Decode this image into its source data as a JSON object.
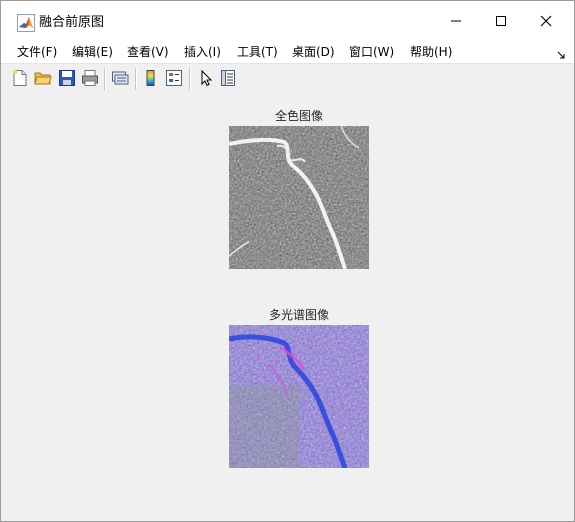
{
  "window": {
    "title": "融合前原图",
    "controls": {
      "minimize": "minimize",
      "maximize": "maximize",
      "close": "close"
    }
  },
  "menu": {
    "items": [
      {
        "label": "文件(F)"
      },
      {
        "label": "编辑(E)"
      },
      {
        "label": "查看(V)"
      },
      {
        "label": "插入(I)"
      },
      {
        "label": "工具(T)"
      },
      {
        "label": "桌面(D)"
      },
      {
        "label": "窗口(W)"
      },
      {
        "label": "帮助(H)"
      }
    ]
  },
  "toolbar": {
    "buttons": [
      {
        "icon": "new-figure-icon"
      },
      {
        "icon": "open-folder-icon"
      },
      {
        "icon": "save-icon"
      },
      {
        "icon": "print-icon"
      },
      {
        "icon": "link-icon"
      },
      {
        "icon": "colorbar-icon"
      },
      {
        "icon": "legend-icon"
      },
      {
        "icon": "pointer-icon"
      },
      {
        "icon": "property-inspector-icon"
      }
    ]
  },
  "figure": {
    "panels": [
      {
        "title": "全色图像",
        "image": "panchromatic-satellite-image"
      },
      {
        "title": "多光谱图像",
        "image": "multispectral-satellite-image"
      }
    ]
  },
  "colors": {
    "window_bg": "#f0f0f0",
    "title_bg": "#ffffff",
    "pan_base": "#6e6e6e",
    "ms_base": "#8a7fd6",
    "river_ms": "#3a4fe0"
  }
}
